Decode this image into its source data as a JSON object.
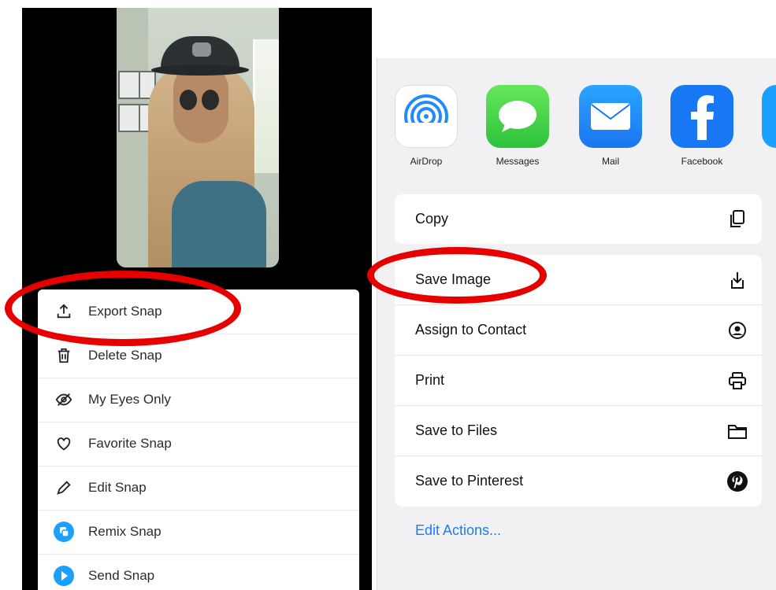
{
  "snap_menu": {
    "items": [
      {
        "label": "Export Snap",
        "icon": "export-icon"
      },
      {
        "label": "Delete Snap",
        "icon": "trash-icon"
      },
      {
        "label": "My Eyes Only",
        "icon": "eye-slash-icon"
      },
      {
        "label": "Favorite Snap",
        "icon": "heart-icon"
      },
      {
        "label": "Edit Snap",
        "icon": "pencil-icon"
      },
      {
        "label": "Remix Snap",
        "icon": "remix-icon"
      },
      {
        "label": "Send Snap",
        "icon": "send-icon"
      }
    ]
  },
  "share_sheet": {
    "apps": [
      {
        "label": "AirDrop",
        "icon": "airdrop-icon"
      },
      {
        "label": "Messages",
        "icon": "messages-icon"
      },
      {
        "label": "Mail",
        "icon": "mail-icon"
      },
      {
        "label": "Facebook",
        "icon": "facebook-icon"
      }
    ],
    "actions_top": [
      {
        "label": "Copy",
        "icon": "copy-icon"
      }
    ],
    "actions": [
      {
        "label": "Save Image",
        "icon": "save-image-icon"
      },
      {
        "label": "Assign to Contact",
        "icon": "contact-icon"
      },
      {
        "label": "Print",
        "icon": "print-icon"
      },
      {
        "label": "Save to Files",
        "icon": "folder-icon"
      },
      {
        "label": "Save to Pinterest",
        "icon": "pinterest-icon"
      }
    ],
    "edit_actions": "Edit Actions..."
  },
  "colors": {
    "highlight_oval": "#e60000",
    "link_blue": "#1a7ef0",
    "snap_blue": "#1aa0ff"
  }
}
